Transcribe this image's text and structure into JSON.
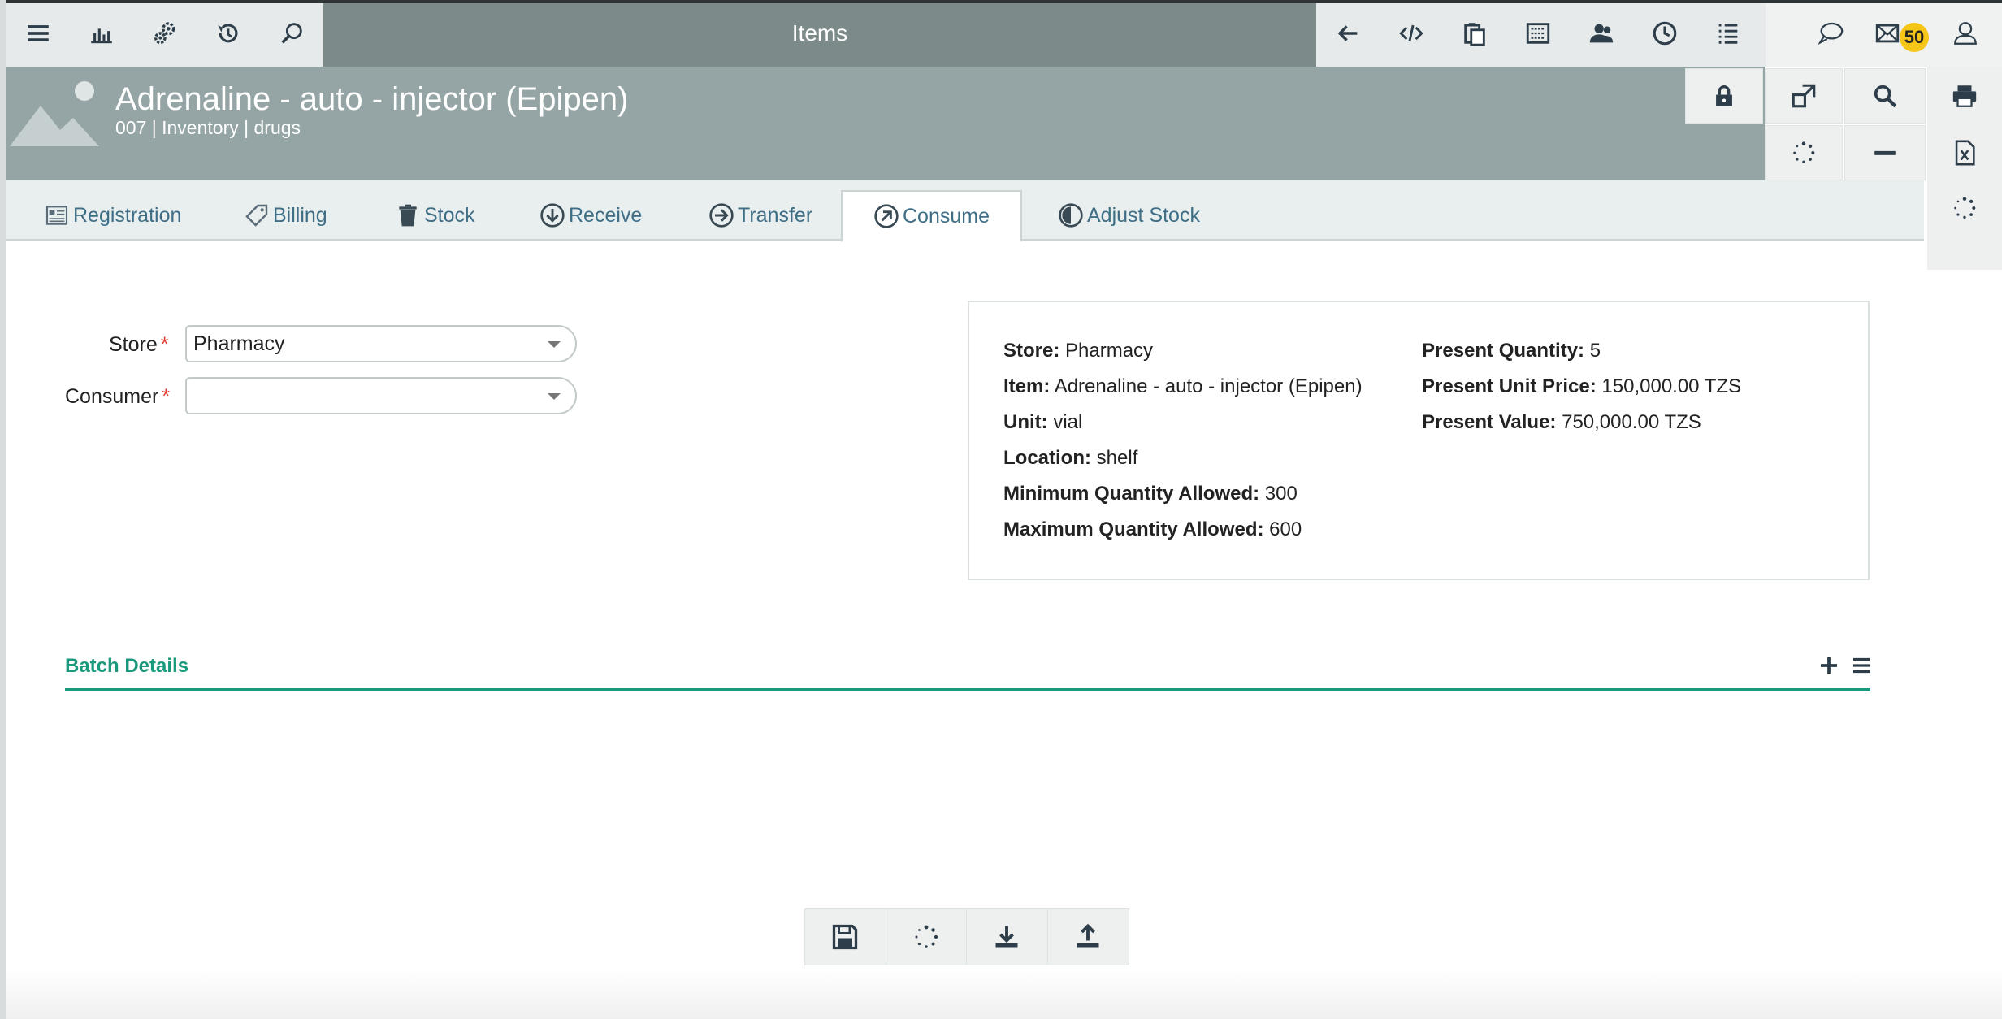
{
  "topbar": {
    "title": "Items",
    "badge_count": "50",
    "left_icons": [
      "menu-icon",
      "chart-icon",
      "settings-gears-icon",
      "history-icon",
      "search-icon"
    ],
    "right_icons": [
      "back-arrow-icon",
      "code-icon",
      "clipboard-icon",
      "barcode-icon",
      "users-icon",
      "clock-icon",
      "list-icon"
    ],
    "msg_icons": [
      "chat-icon",
      "mail-icon",
      "user-profile-icon"
    ]
  },
  "header": {
    "title": "Adrenaline - auto - injector (Epipen)",
    "subtitle": "007 | Inventory | drugs"
  },
  "tabs": [
    {
      "label": "Registration",
      "icon": "registration-icon"
    },
    {
      "label": "Billing",
      "icon": "billing-tag-icon"
    },
    {
      "label": "Stock",
      "icon": "trash-stock-icon"
    },
    {
      "label": "Receive",
      "icon": "arrow-down-circle-icon"
    },
    {
      "label": "Transfer",
      "icon": "arrow-right-circle-icon"
    },
    {
      "label": "Consume",
      "icon": "arrow-up-right-circle-icon",
      "active": true
    },
    {
      "label": "Adjust Stock",
      "icon": "half-circle-icon"
    }
  ],
  "form": {
    "store_label": "Store",
    "store_value": "Pharmacy",
    "consumer_label": "Consumer",
    "consumer_value": "",
    "required_mark": "*"
  },
  "info": {
    "store_key": "Store:",
    "store_val": "Pharmacy",
    "item_key": "Item:",
    "item_val": "Adrenaline - auto - injector (Epipen)",
    "unit_key": "Unit:",
    "unit_val": "vial",
    "location_key": "Location:",
    "location_val": "shelf",
    "min_key": "Minimum Quantity Allowed:",
    "min_val": "300",
    "max_key": "Maximum Quantity Allowed:",
    "max_val": "600",
    "pq_key": "Present Quantity:",
    "pq_val": "5",
    "pup_key": "Present Unit Price:",
    "pup_val": "150,000.00 TZS",
    "pv_key": "Present Value:",
    "pv_val": "750,000.00 TZS"
  },
  "batch": {
    "title": "Batch Details"
  },
  "colors": {
    "accent_green": "#1a9a7c",
    "tab_text": "#3e6e86",
    "header_bg": "#95a5a5",
    "topbar_bg": "#7c8a8a",
    "badge": "#f5c518"
  }
}
